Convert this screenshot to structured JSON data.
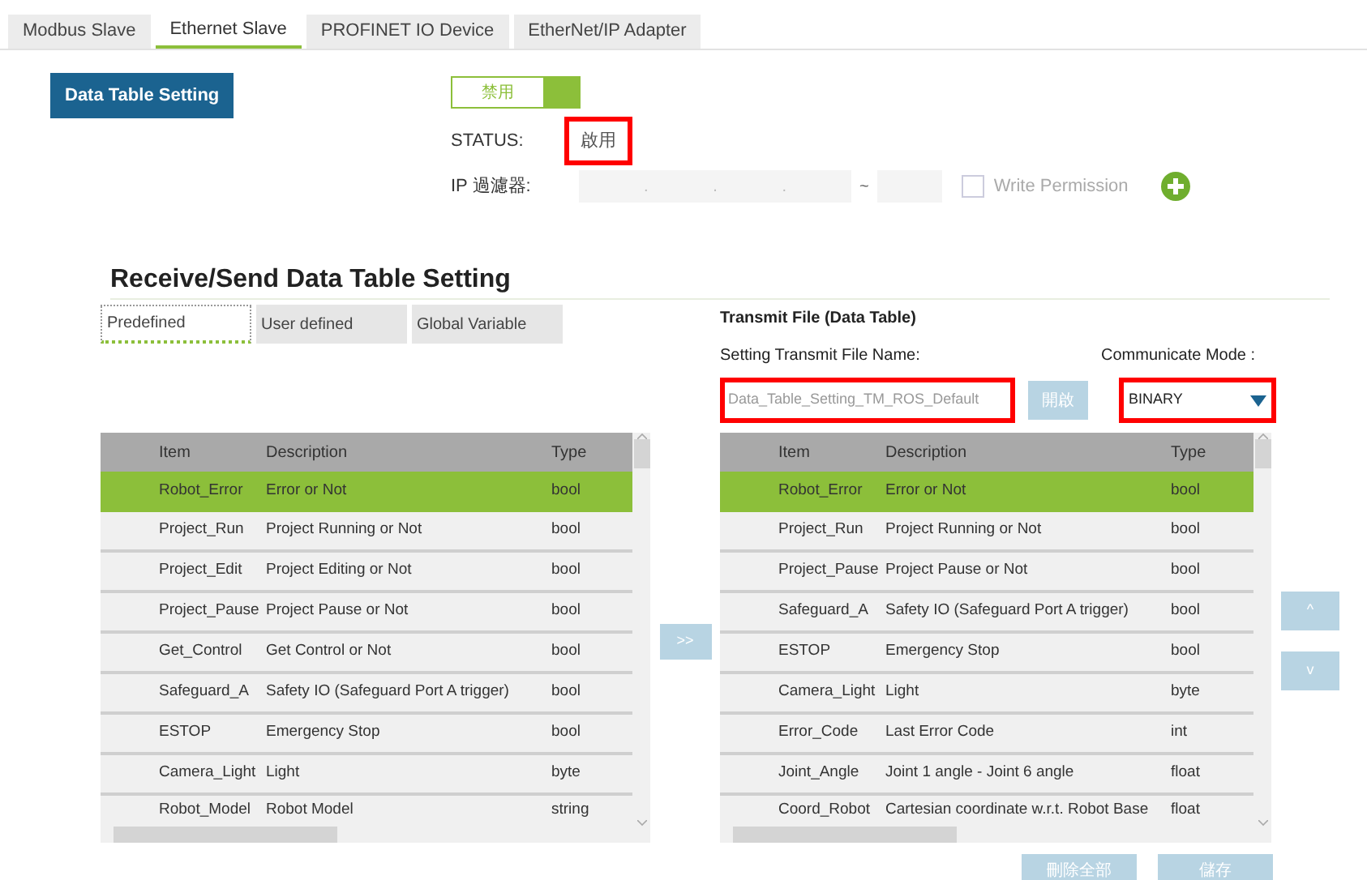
{
  "tabs": [
    {
      "label": "Modbus Slave",
      "selected": false
    },
    {
      "label": "Ethernet Slave",
      "selected": true
    },
    {
      "label": "PROFINET IO Device",
      "selected": false
    },
    {
      "label": "EtherNet/IP Adapter",
      "selected": false
    }
  ],
  "data_table_button": "Data Table Setting",
  "toggle": {
    "label": "禁用",
    "on": true
  },
  "status": {
    "label": "STATUS:",
    "value": "啟用",
    "highlighted": true
  },
  "ip_filter": {
    "label": "IP 過濾器:",
    "separators": [
      ".",
      ".",
      "."
    ],
    "range_mark": "~",
    "write_permission": {
      "label": "Write Permission",
      "checked": false
    }
  },
  "section_title": "Receive/Send Data Table Setting",
  "source_tabs": [
    {
      "label": "Predefined",
      "selected": true
    },
    {
      "label": "User defined",
      "selected": false
    },
    {
      "label": "Global Variable",
      "selected": false
    }
  ],
  "transmit": {
    "title": "Transmit File (Data Table)",
    "file_name_label": "Setting Transmit File Name:",
    "file_name": "Data_Table_Setting_TM_ROS_Default",
    "file_name_highlighted": true,
    "open_button": "開啟",
    "mode_label": "Communicate Mode :",
    "mode": "BINARY",
    "mode_highlighted": true
  },
  "available_table": {
    "columns": [
      "Item",
      "Description",
      "Type"
    ],
    "rows": [
      {
        "cells": [
          "Robot_Error",
          "Error or Not",
          "bool"
        ],
        "selected": true
      },
      {
        "cells": [
          "Project_Run",
          "Project Running or Not",
          "bool"
        ],
        "selected": false
      },
      {
        "cells": [
          "Project_Edit",
          "Project Editing or Not",
          "bool"
        ],
        "selected": false
      },
      {
        "cells": [
          "Project_Pause",
          "Project Pause or Not",
          "bool"
        ],
        "selected": false
      },
      {
        "cells": [
          "Get_Control",
          "Get Control or Not",
          "bool"
        ],
        "selected": false
      },
      {
        "cells": [
          "Safeguard_A",
          "Safety IO (Safeguard Port A trigger)",
          "bool"
        ],
        "selected": false
      },
      {
        "cells": [
          "ESTOP",
          "Emergency Stop",
          "bool"
        ],
        "selected": false
      },
      {
        "cells": [
          "Camera_Light",
          "Light",
          "byte"
        ],
        "selected": false
      },
      {
        "cells": [
          "Robot_Model",
          "Robot Model",
          "string"
        ],
        "selected": false
      }
    ]
  },
  "add_button": ">>",
  "selected_table": {
    "columns": [
      "Item",
      "Description",
      "Type"
    ],
    "rows": [
      {
        "cells": [
          "Robot_Error",
          "Error or Not",
          "bool"
        ],
        "selected": true
      },
      {
        "cells": [
          "Project_Run",
          "Project Running or Not",
          "bool"
        ],
        "selected": false
      },
      {
        "cells": [
          "Project_Pause",
          "Project Pause or Not",
          "bool"
        ],
        "selected": false
      },
      {
        "cells": [
          "Safeguard_A",
          "Safety IO (Safeguard Port A trigger)",
          "bool"
        ],
        "selected": false
      },
      {
        "cells": [
          "ESTOP",
          "Emergency Stop",
          "bool"
        ],
        "selected": false
      },
      {
        "cells": [
          "Camera_Light",
          "Light",
          "byte"
        ],
        "selected": false
      },
      {
        "cells": [
          "Error_Code",
          "Last Error Code",
          "int"
        ],
        "selected": false
      },
      {
        "cells": [
          "Joint_Angle",
          "Joint 1 angle - Joint 6 angle",
          "float"
        ],
        "selected": false
      },
      {
        "cells": [
          "Coord_Robot",
          "Cartesian coordinate w.r.t. Robot Base",
          "float"
        ],
        "selected": false
      }
    ]
  },
  "move_up_button": "^",
  "move_down_button": "v",
  "delete_all_button": "刪除全部",
  "save_button": "儲存"
}
